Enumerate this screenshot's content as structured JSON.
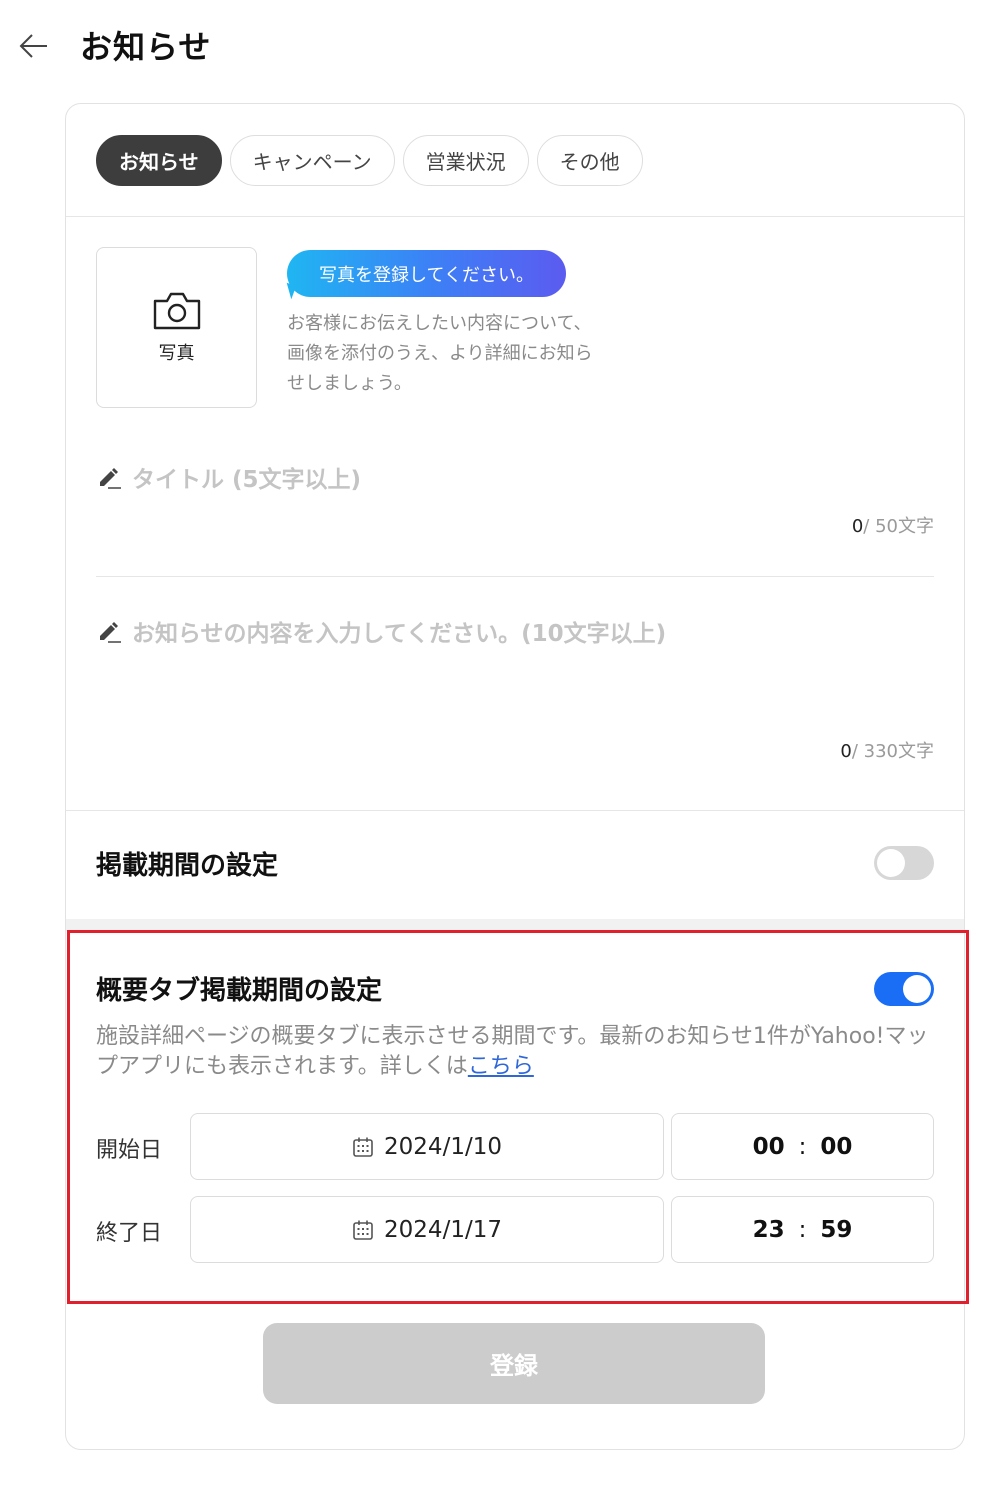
{
  "header": {
    "title": "お知らせ"
  },
  "tabs": [
    {
      "label": "お知らせ",
      "active": true
    },
    {
      "label": "キャンペーン",
      "active": false
    },
    {
      "label": "営業状況",
      "active": false
    },
    {
      "label": "その他",
      "active": false
    }
  ],
  "photo": {
    "label": "写真",
    "bubble": "写真を登録してください。",
    "description": "お客様にお伝えしたい内容について、画像を添付のうえ、より詳細にお知らせしましょう。"
  },
  "title_field": {
    "placeholder": "タイトル (5文字以上)",
    "count": "0",
    "max": "/ 50文字"
  },
  "body_field": {
    "placeholder": "お知らせの内容を入力してください。(10文字以上)",
    "count": "0",
    "max": "/ 330文字"
  },
  "publish_period": {
    "title": "掲載期間の設定",
    "enabled": false
  },
  "overview_period": {
    "title": "概要タブ掲載期間の設定",
    "enabled": true,
    "description": "施設詳細ページの概要タブに表示させる期間です。最新のお知らせ1件がYahoo!マップアプリにも表示されます。詳しくは",
    "link": "こちら",
    "start": {
      "label": "開始日",
      "date": "2024/1/10",
      "hour": "00",
      "minute": "00"
    },
    "end": {
      "label": "終了日",
      "date": "2024/1/17",
      "hour": "23",
      "minute": "59"
    },
    "time_separator": ":"
  },
  "submit": {
    "label": "登録"
  },
  "colors": {
    "accent": "#1a6ef5",
    "highlight_border": "#e0202c",
    "disabled_button": "#cccccc"
  }
}
